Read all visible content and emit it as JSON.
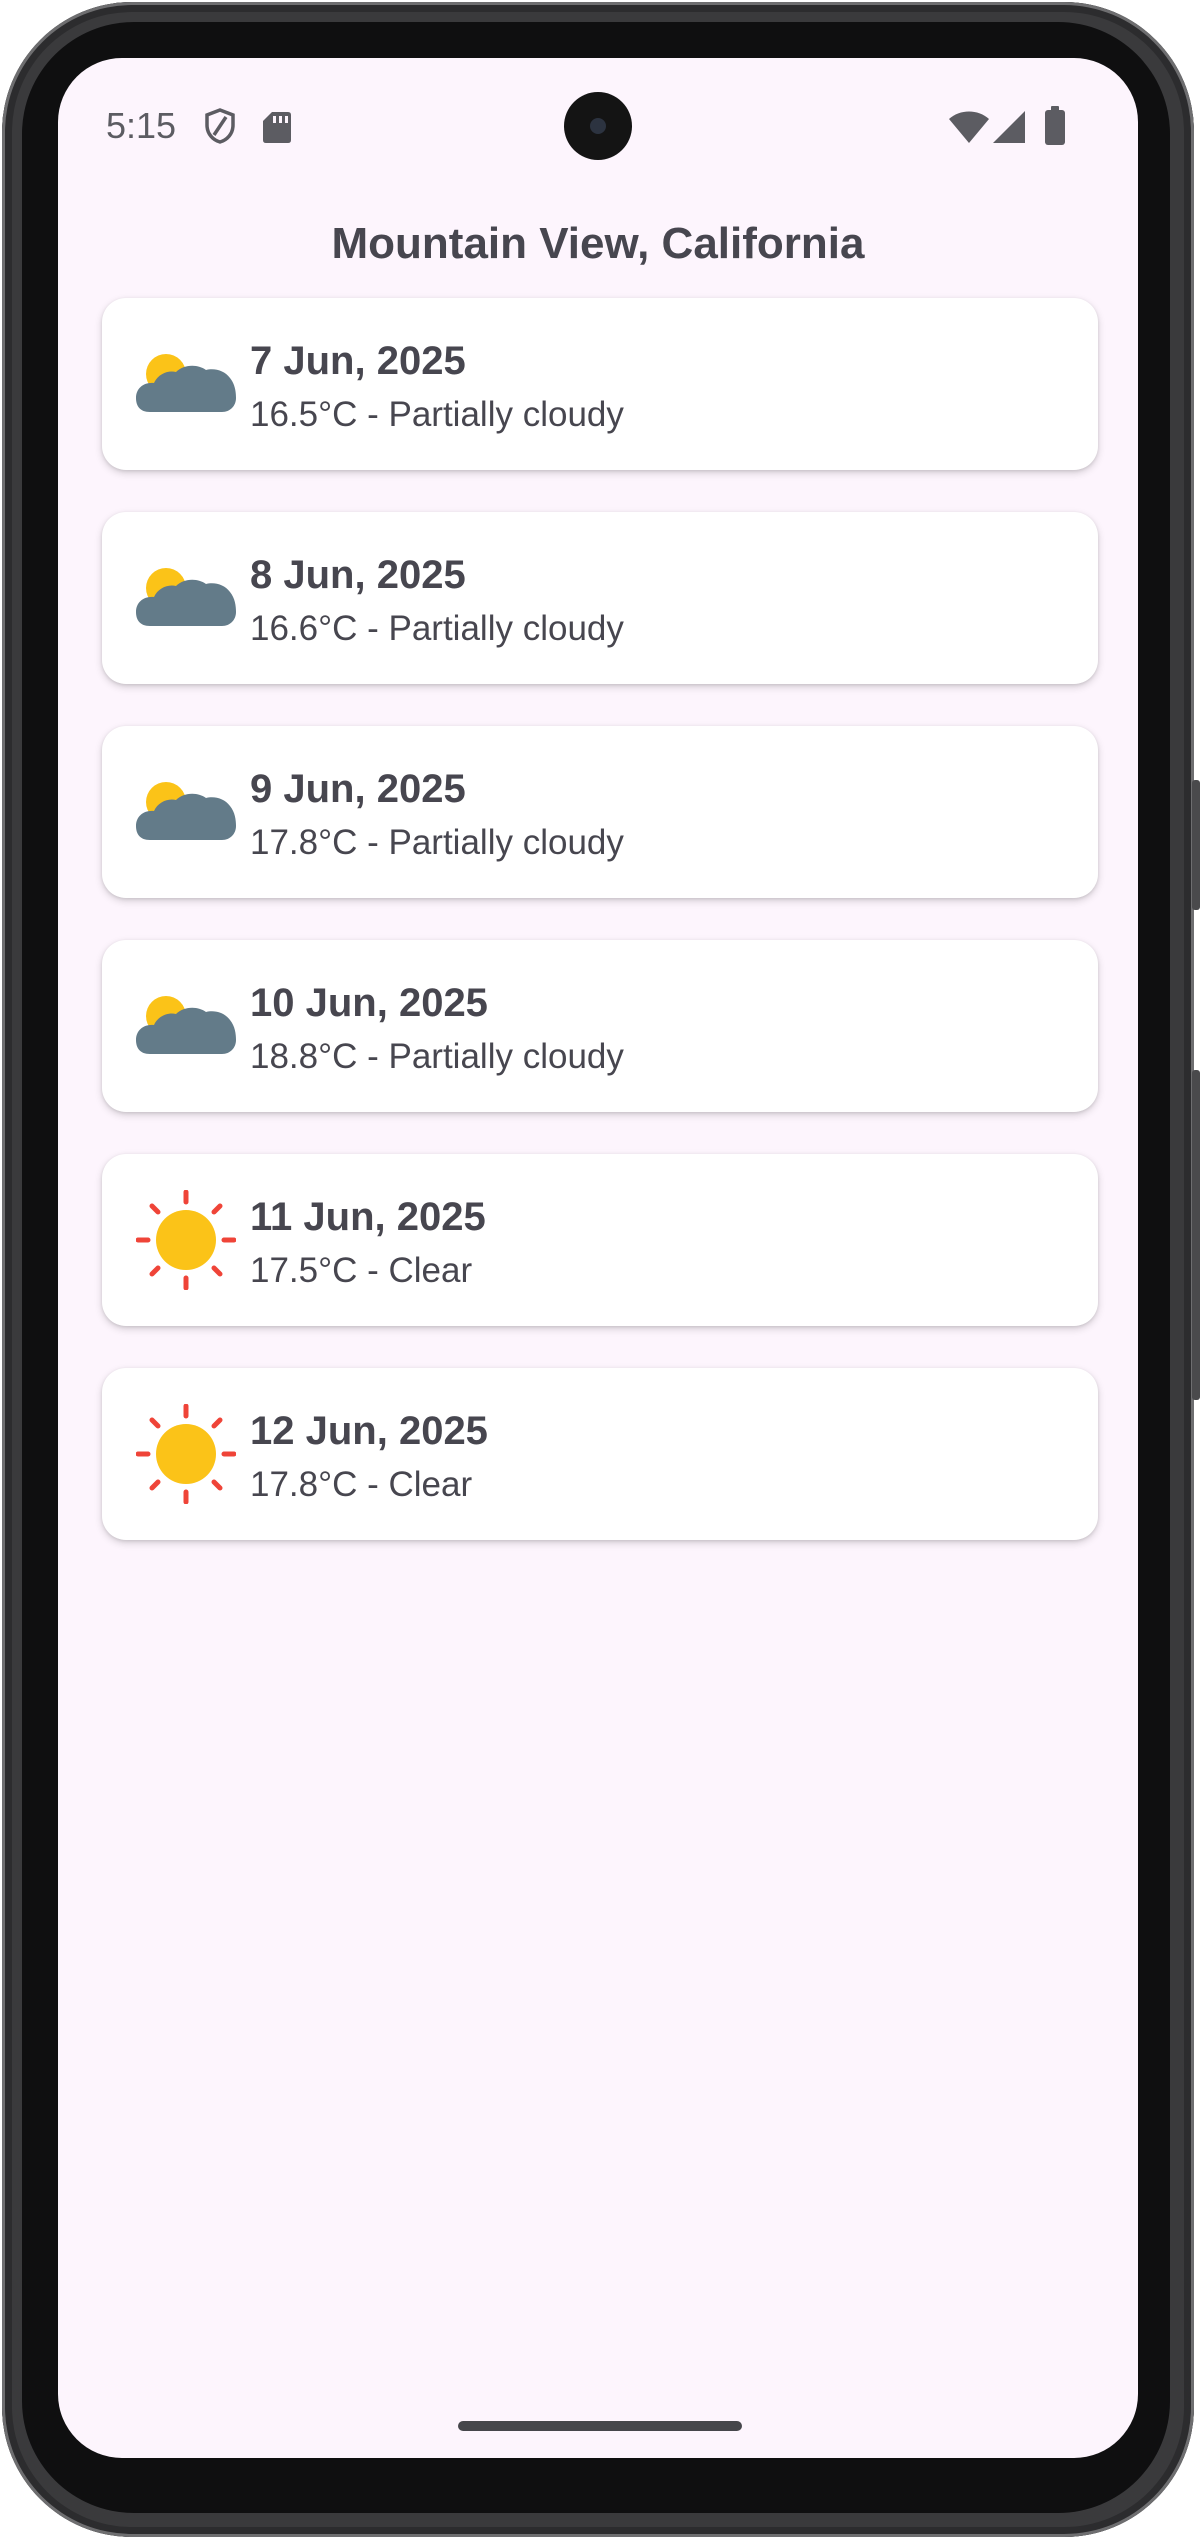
{
  "status_bar": {
    "time": "5:15",
    "icons_left": [
      "shield-icon",
      "sd-card-icon"
    ],
    "icons_right": [
      "wifi-icon",
      "cellular-signal-icon",
      "battery-icon"
    ]
  },
  "header": {
    "title": "Mountain View, California"
  },
  "forecast": [
    {
      "date": "7 Jun, 2025",
      "desc": "16.5°C - Partially cloudy",
      "icon": "partly-cloudy-icon"
    },
    {
      "date": "8 Jun, 2025",
      "desc": "16.6°C - Partially cloudy",
      "icon": "partly-cloudy-icon"
    },
    {
      "date": "9 Jun, 2025",
      "desc": "17.8°C - Partially cloudy",
      "icon": "partly-cloudy-icon"
    },
    {
      "date": "10 Jun, 2025",
      "desc": "18.8°C - Partially cloudy",
      "icon": "partly-cloudy-icon"
    },
    {
      "date": "11 Jun, 2025",
      "desc": "17.5°C - Clear",
      "icon": "sun-icon"
    },
    {
      "date": "12 Jun, 2025",
      "desc": "17.8°C - Clear",
      "icon": "sun-icon"
    }
  ],
  "colors": {
    "screen_background": "#fdf5fd",
    "card_background": "#ffffff",
    "text": "#47464f",
    "sun_yellow": "#fbc318",
    "sun_ray_red": "#ef4438",
    "cloud_gray": "#637b89"
  }
}
